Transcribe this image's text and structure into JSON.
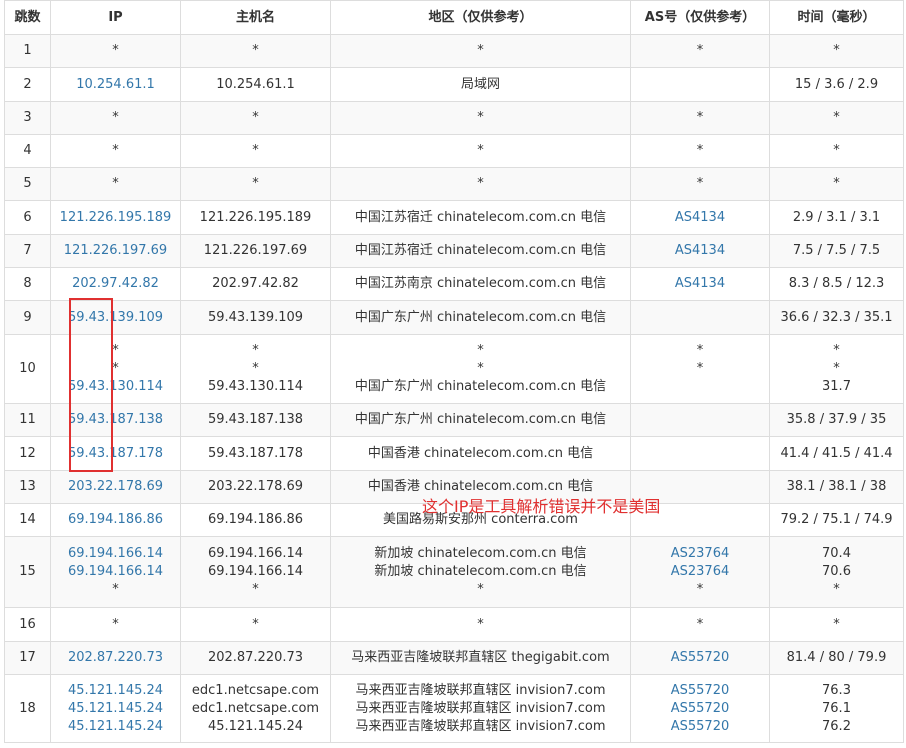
{
  "headers": [
    "跳数",
    "IP",
    "主机名",
    "地区（仅供参考）",
    "AS号（仅供参考）",
    "时间（毫秒）"
  ],
  "rows": [
    {
      "hop": "1",
      "h": 33,
      "ip": [
        "*"
      ],
      "host": [
        "*"
      ],
      "region": [
        "*"
      ],
      "as": [
        "*"
      ],
      "time": [
        "*"
      ]
    },
    {
      "hop": "2",
      "h": 34,
      "ip": [
        "10.254.61.1"
      ],
      "host": [
        "10.254.61.1"
      ],
      "region": [
        "局域网"
      ],
      "as": [
        ""
      ],
      "time": [
        "15 / 3.6 / 2.9"
      ]
    },
    {
      "hop": "3",
      "h": 33,
      "ip": [
        "*"
      ],
      "host": [
        "*"
      ],
      "region": [
        "*"
      ],
      "as": [
        "*"
      ],
      "time": [
        "*"
      ]
    },
    {
      "hop": "4",
      "h": 33,
      "ip": [
        "*"
      ],
      "host": [
        "*"
      ],
      "region": [
        "*"
      ],
      "as": [
        "*"
      ],
      "time": [
        "*"
      ]
    },
    {
      "hop": "5",
      "h": 33,
      "ip": [
        "*"
      ],
      "host": [
        "*"
      ],
      "region": [
        "*"
      ],
      "as": [
        "*"
      ],
      "time": [
        "*"
      ]
    },
    {
      "hop": "6",
      "h": 34,
      "ip": [
        "121.226.195.189"
      ],
      "host": [
        "121.226.195.189"
      ],
      "region": [
        "中国江苏宿迁 chinatelecom.com.cn 电信"
      ],
      "as": [
        "AS4134"
      ],
      "time": [
        "2.9 / 3.1 / 3.1"
      ]
    },
    {
      "hop": "7",
      "h": 33,
      "ip": [
        "121.226.197.69"
      ],
      "host": [
        "121.226.197.69"
      ],
      "region": [
        "中国江苏宿迁 chinatelecom.com.cn 电信"
      ],
      "as": [
        "AS4134"
      ],
      "time": [
        "7.5 / 7.5 / 7.5"
      ]
    },
    {
      "hop": "8",
      "h": 33,
      "ip": [
        "202.97.42.82"
      ],
      "host": [
        "202.97.42.82"
      ],
      "region": [
        "中国江苏南京 chinatelecom.com.cn 电信"
      ],
      "as": [
        "AS4134"
      ],
      "time": [
        "8.3 / 8.5 / 12.3"
      ]
    },
    {
      "hop": "9",
      "h": 34,
      "ip": [
        "59.43.139.109"
      ],
      "host": [
        "59.43.139.109"
      ],
      "region": [
        "中国广东广州 chinatelecom.com.cn 电信"
      ],
      "as": [
        ""
      ],
      "time": [
        "36.6 / 32.3 / 35.1"
      ]
    },
    {
      "hop": "10",
      "h": 69,
      "ip": [
        "*",
        "*",
        "59.43.130.114"
      ],
      "host": [
        "*",
        "*",
        "59.43.130.114"
      ],
      "region": [
        "*",
        "*",
        "中国广东广州 chinatelecom.com.cn 电信"
      ],
      "as": [
        "*",
        "*",
        ""
      ],
      "time": [
        "*",
        "*",
        "31.7"
      ]
    },
    {
      "hop": "11",
      "h": 33,
      "ip": [
        "59.43.187.138"
      ],
      "host": [
        "59.43.187.138"
      ],
      "region": [
        "中国广东广州 chinatelecom.com.cn 电信"
      ],
      "as": [
        ""
      ],
      "time": [
        "35.8 / 37.9 / 35"
      ]
    },
    {
      "hop": "12",
      "h": 34,
      "ip": [
        "59.43.187.178"
      ],
      "host": [
        "59.43.187.178"
      ],
      "region": [
        "中国香港 chinatelecom.com.cn 电信"
      ],
      "as": [
        ""
      ],
      "time": [
        "41.4 / 41.5 / 41.4"
      ]
    },
    {
      "hop": "13",
      "h": 33,
      "ip": [
        "203.22.178.69"
      ],
      "host": [
        "203.22.178.69"
      ],
      "region": [
        "中国香港 chinatelecom.com.cn 电信"
      ],
      "as": [
        ""
      ],
      "time": [
        "38.1 / 38.1 / 38"
      ]
    },
    {
      "hop": "14",
      "h": 33,
      "ip": [
        "69.194.186.86"
      ],
      "host": [
        "69.194.186.86"
      ],
      "region": [
        "美国路易斯安那州 conterra.com"
      ],
      "as": [
        ""
      ],
      "time": [
        "79.2 / 75.1 / 74.9"
      ]
    },
    {
      "hop": "15",
      "h": 71,
      "ip": [
        "69.194.166.14",
        "69.194.166.14",
        "*"
      ],
      "host": [
        "69.194.166.14",
        "69.194.166.14",
        "*"
      ],
      "region": [
        "新加坡 chinatelecom.com.cn 电信",
        "新加坡 chinatelecom.com.cn 电信",
        "*"
      ],
      "as": [
        "AS23764",
        "AS23764",
        "*"
      ],
      "time": [
        "70.4",
        "70.6",
        "*"
      ]
    },
    {
      "hop": "16",
      "h": 34,
      "ip": [
        "*"
      ],
      "host": [
        "*"
      ],
      "region": [
        "*"
      ],
      "as": [
        "*"
      ],
      "time": [
        "*"
      ]
    },
    {
      "hop": "17",
      "h": 33,
      "ip": [
        "202.87.220.73"
      ],
      "host": [
        "202.87.220.73"
      ],
      "region": [
        "马来西亚吉隆坡联邦直辖区 thegigabit.com"
      ],
      "as": [
        "AS55720"
      ],
      "time": [
        "81.4 / 80 / 79.9"
      ]
    },
    {
      "hop": "18",
      "h": 68,
      "ip": [
        "45.121.145.24",
        "45.121.145.24",
        "45.121.145.24"
      ],
      "host": [
        "edc1.netcsape.com",
        "edc1.netcsape.com",
        "45.121.145.24"
      ],
      "region": [
        "马来西亚吉隆坡联邦直辖区 invision7.com",
        "马来西亚吉隆坡联邦直辖区 invision7.com",
        "马来西亚吉隆坡联邦直辖区 invision7.com"
      ],
      "as": [
        "AS55720",
        "AS55720",
        "AS55720"
      ],
      "time": [
        "76.3",
        "76.1",
        "76.2"
      ]
    }
  ],
  "annotation": "这个IP是工具解析错误并不是美国",
  "colors": {
    "link": "#3377aa",
    "annotation": "#e03030",
    "border": "#dddddd"
  }
}
